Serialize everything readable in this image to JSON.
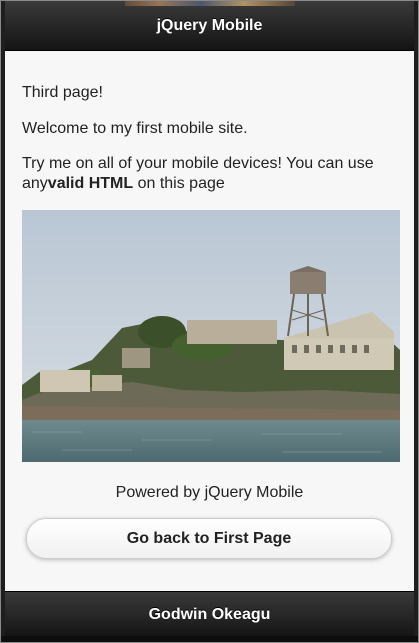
{
  "header": {
    "title": "jQuery Mobile"
  },
  "content": {
    "line1": "Third page!",
    "line2": "Welcome to my first mobile site.",
    "line3_prefix": "Try me on all of your mobile devices! You can use any",
    "line3_bold": "valid HTML",
    "line3_suffix": " on this page",
    "powered_by": "Powered by jQuery Mobile",
    "button_label": "Go back to First Page"
  },
  "footer": {
    "title": "Godwin Okeagu"
  },
  "colors": {
    "bar_dark": "#141414",
    "bar_light": "#3a3a3a",
    "page_bg": "#f7f7f7",
    "text": "#222222"
  }
}
